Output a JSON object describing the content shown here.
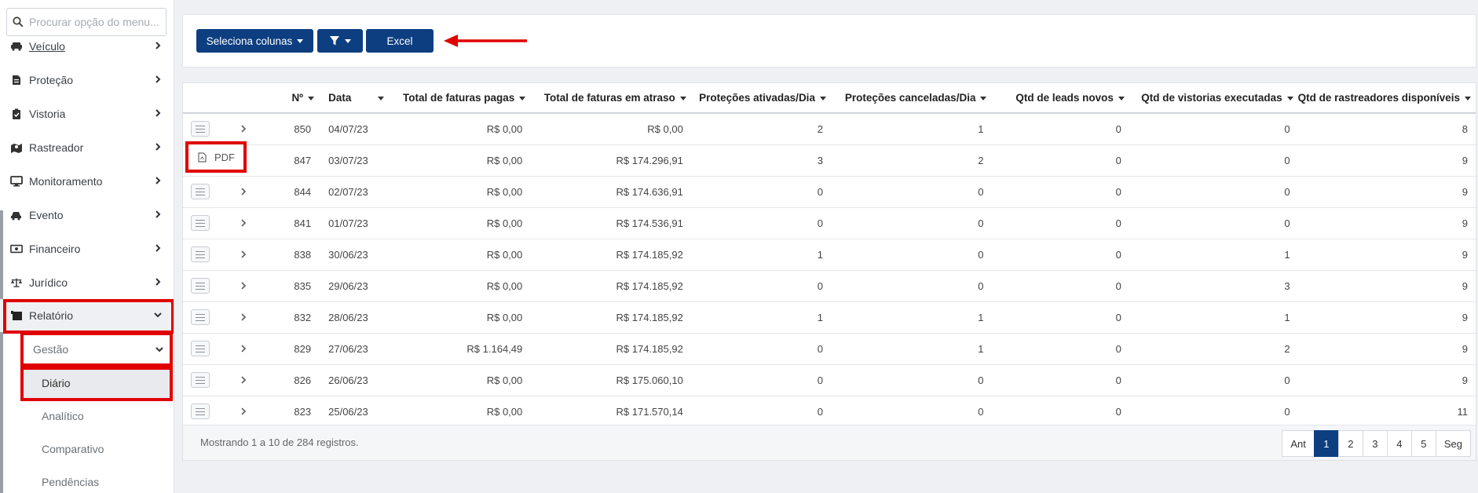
{
  "sidebar": {
    "search_placeholder": "Procurar opção do menu...",
    "items": [
      {
        "label": "Veículo",
        "icon": "car-icon"
      },
      {
        "label": "Proteção",
        "icon": "document-icon"
      },
      {
        "label": "Vistoria",
        "icon": "clipboard-check-icon"
      },
      {
        "label": "Rastreador",
        "icon": "map-marker-icon"
      },
      {
        "label": "Monitoramento",
        "icon": "monitor-icon"
      },
      {
        "label": "Evento",
        "icon": "car-crash-icon"
      },
      {
        "label": "Financeiro",
        "icon": "money-bill-icon"
      },
      {
        "label": "Jurídico",
        "icon": "balance-scale-icon"
      },
      {
        "label": "Relatório",
        "icon": "report-icon"
      }
    ],
    "submenu_label": "Gestão",
    "leaf_items": [
      "Diário",
      "Analítico",
      "Comparativo",
      "Pendências"
    ]
  },
  "toolbar": {
    "select_columns_label": "Seleciona colunas",
    "excel_label": "Excel"
  },
  "pdf_popup_label": "PDF",
  "table": {
    "headers": [
      "Nº",
      "Data",
      "Total de faturas pagas",
      "Total de faturas em atraso",
      "Proteções ativadas/Dia",
      "Proteções canceladas/Dia",
      "Qtd de leads novos",
      "Qtd de vistorias executadas",
      "Qtd de rastreadores disponíveis"
    ],
    "rows": [
      [
        "850",
        "04/07/23",
        "R$ 0,00",
        "R$ 0,00",
        "2",
        "1",
        "0",
        "0",
        "8"
      ],
      [
        "847",
        "03/07/23",
        "R$ 0,00",
        "R$ 174.296,91",
        "3",
        "2",
        "0",
        "0",
        "9"
      ],
      [
        "844",
        "02/07/23",
        "R$ 0,00",
        "R$ 174.636,91",
        "0",
        "0",
        "0",
        "0",
        "9"
      ],
      [
        "841",
        "01/07/23",
        "R$ 0,00",
        "R$ 174.536,91",
        "0",
        "0",
        "0",
        "0",
        "9"
      ],
      [
        "838",
        "30/06/23",
        "R$ 0,00",
        "R$ 174.185,92",
        "1",
        "0",
        "0",
        "1",
        "9"
      ],
      [
        "835",
        "29/06/23",
        "R$ 0,00",
        "R$ 174.185,92",
        "0",
        "0",
        "0",
        "3",
        "9"
      ],
      [
        "832",
        "28/06/23",
        "R$ 0,00",
        "R$ 174.185,92",
        "1",
        "1",
        "0",
        "1",
        "9"
      ],
      [
        "829",
        "27/06/23",
        "R$ 1.164,49",
        "R$ 174.185,92",
        "0",
        "1",
        "0",
        "2",
        "9"
      ],
      [
        "826",
        "26/06/23",
        "R$ 0,00",
        "R$ 175.060,10",
        "0",
        "0",
        "0",
        "0",
        "9"
      ],
      [
        "823",
        "25/06/23",
        "R$ 0,00",
        "R$ 171.570,14",
        "0",
        "0",
        "0",
        "0",
        "11"
      ]
    ],
    "footer_info": "Mostrando 1 a 10 de 284 registros."
  },
  "pagination": {
    "prev": "Ant",
    "pages": [
      "1",
      "2",
      "3",
      "4",
      "5"
    ],
    "next": "Seg",
    "current": "1"
  },
  "colors": {
    "primary": "#0d3e80",
    "annotation_red": "#e00000"
  }
}
